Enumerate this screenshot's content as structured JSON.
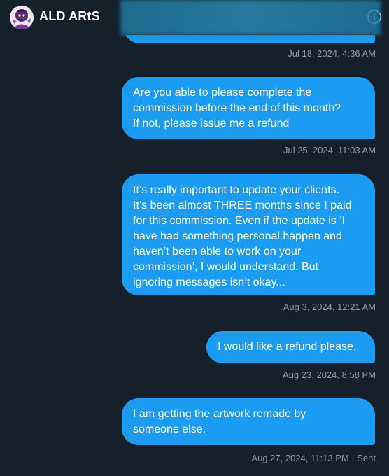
{
  "header": {
    "title": "ALD ARtS",
    "avatar_icon": "avatar-image",
    "info_icon": "info-icon"
  },
  "messages": [
    {
      "text": "",
      "timestamp": "Jul 18, 2024, 4:36 AM",
      "blurred": true
    },
    {
      "text": "Are you able to please complete the\ncommission before the end of this month?\nIf not, please issue me a refund",
      "timestamp": "Jul 25, 2024, 11:03 AM"
    },
    {
      "text": "It’s really important to update your clients.\nIt’s been almost THREE months since I paid\nfor this commission. Even if the update is ‘I\nhave had something personal happen and\nhaven’t been able to work on your\ncommission’, I would understand. But\nignoring messages isn’t okay...",
      "timestamp": "Aug 3, 2024, 12:21 AM"
    },
    {
      "text": "I would like a refund please.",
      "timestamp": "Aug 23, 2024, 8:58 PM"
    },
    {
      "text": "I am getting the artwork remade by\nsomeone else.",
      "timestamp": "Aug 27, 2024, 11:13 PM · Sent"
    }
  ],
  "colors": {
    "background": "#15202b",
    "bubble": "#1d9bf0",
    "timestamp": "#8b98a5",
    "text": "#ffffff"
  }
}
